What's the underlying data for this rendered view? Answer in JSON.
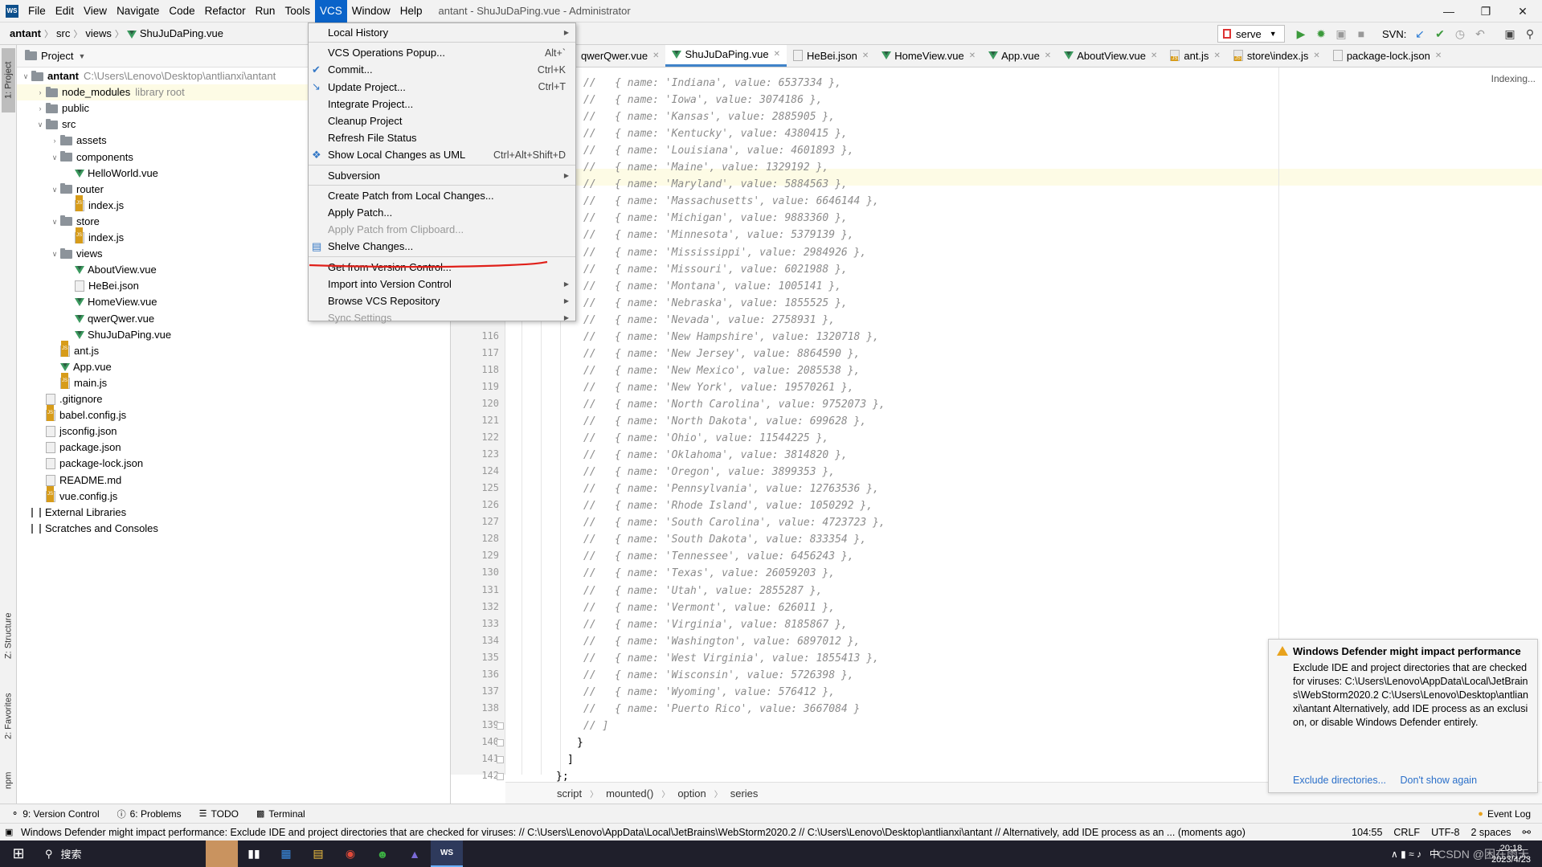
{
  "app": {
    "window_title": "antant - ShuJuDaPing.vue - Administrator",
    "logo_text": "WS",
    "menus": [
      "File",
      "Edit",
      "View",
      "Navigate",
      "Code",
      "Refactor",
      "Run",
      "Tools",
      "VCS",
      "Window",
      "Help"
    ],
    "active_menu": "VCS"
  },
  "navbar": {
    "crumbs": [
      "antant",
      "src",
      "views",
      "ShuJuDaPing.vue"
    ],
    "run_config": "serve",
    "svn_label": "SVN:"
  },
  "sidebar_tabs": {
    "project": "1: Project",
    "structure": "Z: Structure",
    "favorites": "2: Favorites",
    "npm": "npm"
  },
  "project": {
    "header": "Project",
    "tree": [
      {
        "label": "antant",
        "extra": "C:\\Users\\Lenovo\\Desktop\\antlianxi\\antant",
        "type": "folder",
        "depth": 0,
        "open": true
      },
      {
        "label": "node_modules",
        "extra": "library root",
        "type": "folder",
        "depth": 1,
        "open": false
      },
      {
        "label": "public",
        "extra": "",
        "type": "folder",
        "depth": 1,
        "open": false
      },
      {
        "label": "src",
        "extra": "",
        "type": "folder",
        "depth": 1,
        "open": true
      },
      {
        "label": "assets",
        "extra": "",
        "type": "folder",
        "depth": 2,
        "open": false
      },
      {
        "label": "components",
        "extra": "",
        "type": "folder",
        "depth": 2,
        "open": true
      },
      {
        "label": "HelloWorld.vue",
        "extra": "",
        "type": "vue",
        "depth": 3
      },
      {
        "label": "router",
        "extra": "",
        "type": "folder",
        "depth": 2,
        "open": true
      },
      {
        "label": "index.js",
        "extra": "",
        "type": "js",
        "depth": 3
      },
      {
        "label": "store",
        "extra": "",
        "type": "folder",
        "depth": 2,
        "open": true
      },
      {
        "label": "index.js",
        "extra": "",
        "type": "js",
        "depth": 3
      },
      {
        "label": "views",
        "extra": "",
        "type": "folder",
        "depth": 2,
        "open": true
      },
      {
        "label": "AboutView.vue",
        "extra": "",
        "type": "vue",
        "depth": 3
      },
      {
        "label": "HeBei.json",
        "extra": "",
        "type": "json",
        "depth": 3
      },
      {
        "label": "HomeView.vue",
        "extra": "",
        "type": "vue",
        "depth": 3
      },
      {
        "label": "qwerQwer.vue",
        "extra": "",
        "type": "vue",
        "depth": 3
      },
      {
        "label": "ShuJuDaPing.vue",
        "extra": "",
        "type": "vue",
        "depth": 3
      },
      {
        "label": "ant.js",
        "extra": "",
        "type": "js",
        "depth": 2
      },
      {
        "label": "App.vue",
        "extra": "",
        "type": "vue",
        "depth": 2
      },
      {
        "label": "main.js",
        "extra": "",
        "type": "js",
        "depth": 2
      },
      {
        "label": ".gitignore",
        "extra": "",
        "type": "json",
        "depth": 1
      },
      {
        "label": "babel.config.js",
        "extra": "",
        "type": "js",
        "depth": 1
      },
      {
        "label": "jsconfig.json",
        "extra": "",
        "type": "json",
        "depth": 1
      },
      {
        "label": "package.json",
        "extra": "",
        "type": "json",
        "depth": 1
      },
      {
        "label": "package-lock.json",
        "extra": "",
        "type": "json",
        "depth": 1
      },
      {
        "label": "README.md",
        "extra": "",
        "type": "json",
        "depth": 1
      },
      {
        "label": "vue.config.js",
        "extra": "",
        "type": "js",
        "depth": 1
      },
      {
        "label": "External Libraries",
        "extra": "",
        "type": "lib",
        "depth": 0
      },
      {
        "label": "Scratches and Consoles",
        "extra": "",
        "type": "lib",
        "depth": 0
      }
    ]
  },
  "vcs_menu": {
    "items": [
      {
        "label": "Local History",
        "shortcut": "",
        "submenu": true,
        "disabled": false,
        "icon": ""
      },
      {
        "sep": true
      },
      {
        "label": "VCS Operations Popup...",
        "shortcut": "Alt+`",
        "submenu": false,
        "disabled": false,
        "icon": ""
      },
      {
        "label": "Commit...",
        "shortcut": "Ctrl+K",
        "submenu": false,
        "disabled": false,
        "icon": "check-icon"
      },
      {
        "label": "Update Project...",
        "shortcut": "Ctrl+T",
        "submenu": false,
        "disabled": false,
        "icon": "update-icon"
      },
      {
        "label": "Integrate Project...",
        "shortcut": "",
        "submenu": false,
        "disabled": false,
        "icon": ""
      },
      {
        "label": "Cleanup Project",
        "shortcut": "",
        "submenu": false,
        "disabled": false,
        "icon": ""
      },
      {
        "label": "Refresh File Status",
        "shortcut": "",
        "submenu": false,
        "disabled": false,
        "icon": ""
      },
      {
        "label": "Show Local Changes as UML",
        "shortcut": "Ctrl+Alt+Shift+D",
        "submenu": false,
        "disabled": false,
        "icon": "uml-icon"
      },
      {
        "sep": true
      },
      {
        "label": "Subversion",
        "shortcut": "",
        "submenu": true,
        "disabled": false,
        "icon": ""
      },
      {
        "sep": true
      },
      {
        "label": "Create Patch from Local Changes...",
        "shortcut": "",
        "submenu": false,
        "disabled": false,
        "icon": ""
      },
      {
        "label": "Apply Patch...",
        "shortcut": "",
        "submenu": false,
        "disabled": false,
        "icon": ""
      },
      {
        "label": "Apply Patch from Clipboard...",
        "shortcut": "",
        "submenu": false,
        "disabled": true,
        "icon": ""
      },
      {
        "label": "Shelve Changes...",
        "shortcut": "",
        "submenu": false,
        "disabled": false,
        "icon": "shelve-icon"
      },
      {
        "sep": true
      },
      {
        "label": "Get from Version Control...",
        "shortcut": "",
        "submenu": false,
        "disabled": false,
        "icon": ""
      },
      {
        "label": "Import into Version Control",
        "shortcut": "",
        "submenu": true,
        "disabled": false,
        "icon": ""
      },
      {
        "label": "Browse VCS Repository",
        "shortcut": "",
        "submenu": true,
        "disabled": false,
        "icon": ""
      },
      {
        "label": "Sync Settings",
        "shortcut": "",
        "submenu": true,
        "disabled": true,
        "icon": ""
      }
    ]
  },
  "editor": {
    "tabs": [
      {
        "label": "qwerQwer.vue",
        "type": "vue",
        "selected": false
      },
      {
        "label": "ShuJuDaPing.vue",
        "type": "vue",
        "selected": true
      },
      {
        "label": "HeBei.json",
        "type": "json",
        "selected": false
      },
      {
        "label": "HomeView.vue",
        "type": "vue",
        "selected": false
      },
      {
        "label": "App.vue",
        "type": "vue",
        "selected": false
      },
      {
        "label": "AboutView.vue",
        "type": "vue",
        "selected": false
      },
      {
        "label": "ant.js",
        "type": "js",
        "selected": false
      },
      {
        "label": "store\\index.js",
        "type": "js",
        "selected": false
      },
      {
        "label": "package-lock.json",
        "type": "json",
        "selected": false
      }
    ],
    "indexing_label": "Indexing...",
    "code_lines": [
      {
        "n": "",
        "text": "//   { name: 'Indiana', value: 6537334 },"
      },
      {
        "n": "",
        "text": "//   { name: 'Iowa', value: 3074186 },"
      },
      {
        "n": "",
        "text": "//   { name: 'Kansas', value: 2885905 },"
      },
      {
        "n": "",
        "text": "//   { name: 'Kentucky', value: 4380415 },"
      },
      {
        "n": "",
        "text": "//   { name: 'Louisiana', value: 4601893 },"
      },
      {
        "n": "",
        "text": "//   { name: 'Maine', value: 1329192 },"
      },
      {
        "n": "",
        "text": "//   { name: 'Maryland', value: 5884563 },"
      },
      {
        "n": "",
        "text": "//   { name: 'Massachusetts', value: 6646144 },"
      },
      {
        "n": "",
        "text": "//   { name: 'Michigan', value: 9883360 },"
      },
      {
        "n": "",
        "text": "//   { name: 'Minnesota', value: 5379139 },"
      },
      {
        "n": "",
        "text": "//   { name: 'Mississippi', value: 2984926 },"
      },
      {
        "n": "",
        "text": "//   { name: 'Missouri', value: 6021988 },"
      },
      {
        "n": "",
        "text": "//   { name: 'Montana', value: 1005141 },"
      },
      {
        "n": "",
        "text": "//   { name: 'Nebraska', value: 1855525 },"
      },
      {
        "n": "",
        "text": "//   { name: 'Nevada', value: 2758931 },"
      },
      {
        "n": "116",
        "text": "//   { name: 'New Hampshire', value: 1320718 },"
      },
      {
        "n": "117",
        "text": "//   { name: 'New Jersey', value: 8864590 },"
      },
      {
        "n": "118",
        "text": "//   { name: 'New Mexico', value: 2085538 },"
      },
      {
        "n": "119",
        "text": "//   { name: 'New York', value: 19570261 },"
      },
      {
        "n": "120",
        "text": "//   { name: 'North Carolina', value: 9752073 },"
      },
      {
        "n": "121",
        "text": "//   { name: 'North Dakota', value: 699628 },"
      },
      {
        "n": "122",
        "text": "//   { name: 'Ohio', value: 11544225 },"
      },
      {
        "n": "123",
        "text": "//   { name: 'Oklahoma', value: 3814820 },"
      },
      {
        "n": "124",
        "text": "//   { name: 'Oregon', value: 3899353 },"
      },
      {
        "n": "125",
        "text": "//   { name: 'Pennsylvania', value: 12763536 },"
      },
      {
        "n": "126",
        "text": "//   { name: 'Rhode Island', value: 1050292 },"
      },
      {
        "n": "127",
        "text": "//   { name: 'South Carolina', value: 4723723 },"
      },
      {
        "n": "128",
        "text": "//   { name: 'South Dakota', value: 833354 },"
      },
      {
        "n": "129",
        "text": "//   { name: 'Tennessee', value: 6456243 },"
      },
      {
        "n": "130",
        "text": "//   { name: 'Texas', value: 26059203 },"
      },
      {
        "n": "131",
        "text": "//   { name: 'Utah', value: 2855287 },"
      },
      {
        "n": "132",
        "text": "//   { name: 'Vermont', value: 626011 },"
      },
      {
        "n": "133",
        "text": "//   { name: 'Virginia', value: 8185867 },"
      },
      {
        "n": "134",
        "text": "//   { name: 'Washington', value: 6897012 },"
      },
      {
        "n": "135",
        "text": "//   { name: 'West Virginia', value: 1855413 },"
      },
      {
        "n": "136",
        "text": "//   { name: 'Wisconsin', value: 5726398 },"
      },
      {
        "n": "137",
        "text": "//   { name: 'Wyoming', value: 576412 },"
      },
      {
        "n": "138",
        "text": "//   { name: 'Puerto Rico', value: 3667084 }"
      },
      {
        "n": "139",
        "text": "// ]"
      },
      {
        "n": "140",
        "text": "}"
      },
      {
        "n": "141",
        "text": "]"
      },
      {
        "n": "142",
        "text": "};"
      }
    ],
    "breadcrumbs": [
      "script",
      "mounted()",
      "option",
      "series"
    ]
  },
  "notification": {
    "title": "Windows Defender might impact performance",
    "body": "Exclude IDE and project directories that are checked for viruses: C:\\Users\\Lenovo\\AppData\\Local\\JetBrains\\WebStorm2020.2 C:\\Users\\Lenovo\\Desktop\\antlianxi\\antant Alternatively, add IDE process as an exclusion, or disable Windows Defender entirely.",
    "link_exclude": "Exclude directories...",
    "link_dont_show": "Don't show again"
  },
  "toolwindows": {
    "version_control": "9: Version Control",
    "problems": "6: Problems",
    "todo": "TODO",
    "terminal": "Terminal",
    "event_log": "Event Log"
  },
  "statusbar": {
    "message": "Windows Defender might impact performance: Exclude IDE and project directories that are checked for viruses: // C:\\Users\\Lenovo\\AppData\\Local\\JetBrains\\WebStorm2020.2 // C:\\Users\\Lenovo\\Desktop\\antlianxi\\antant // Alternatively, add IDE process as an ... (moments ago)",
    "position": "104:55",
    "line_sep": "CRLF",
    "encoding": "UTF-8",
    "indent": "2 spaces"
  },
  "taskbar": {
    "search_text": "搜索",
    "time": "20:18",
    "date": "2023/4/23",
    "ime": "中",
    "watermark": "CSDN @困在雨天"
  },
  "colors": {
    "accent": "#0a63c9",
    "current_line": "#fdfbe5",
    "annotation_red": "#e0201a"
  }
}
